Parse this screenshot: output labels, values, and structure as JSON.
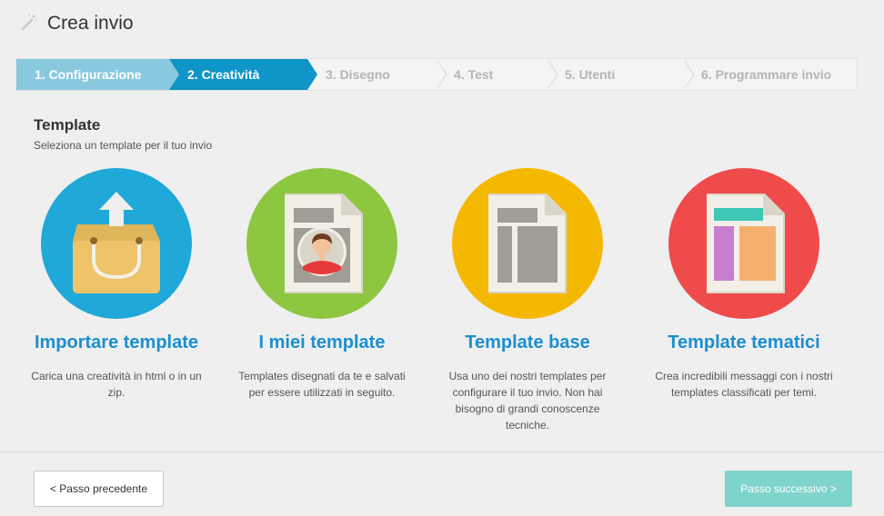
{
  "header": {
    "title": "Crea invio",
    "icon": "magic-wand-icon"
  },
  "steps": [
    {
      "label": "1. Configurazione",
      "state": "done"
    },
    {
      "label": "2. Creatività",
      "state": "active"
    },
    {
      "label": "3. Disegno",
      "state": "pending"
    },
    {
      "label": "4. Test",
      "state": "pending"
    },
    {
      "label": "5. Utenti",
      "state": "pending"
    },
    {
      "label": "6. Programmare invio",
      "state": "pending"
    }
  ],
  "section": {
    "title": "Template",
    "subtitle": "Seleziona un template per il tuo invio"
  },
  "cards": [
    {
      "title": "Importare template",
      "description": "Carica una creatività in html o in un zip.",
      "color": "#1fa8d8",
      "icon": "upload-box-icon"
    },
    {
      "title": "I miei template",
      "description": "Templates disegnati da te e salvati per essere utilizzati in seguito.",
      "color": "#8dc63f",
      "icon": "user-template-icon"
    },
    {
      "title": "Template base",
      "description": "Usa uno dei nostri templates per configurare il tuo invio. Non hai bisogno di grandi conoscenze tecniche.",
      "color": "#f5b800",
      "icon": "base-template-icon"
    },
    {
      "title": "Template tematici",
      "description": "Crea incredibili messaggi con i nostri templates classificati per temi.",
      "color": "#ef4b4b",
      "icon": "themed-template-icon"
    }
  ],
  "footer": {
    "prev_label": "< Passo precedente",
    "next_label": "Passo successivo >"
  }
}
